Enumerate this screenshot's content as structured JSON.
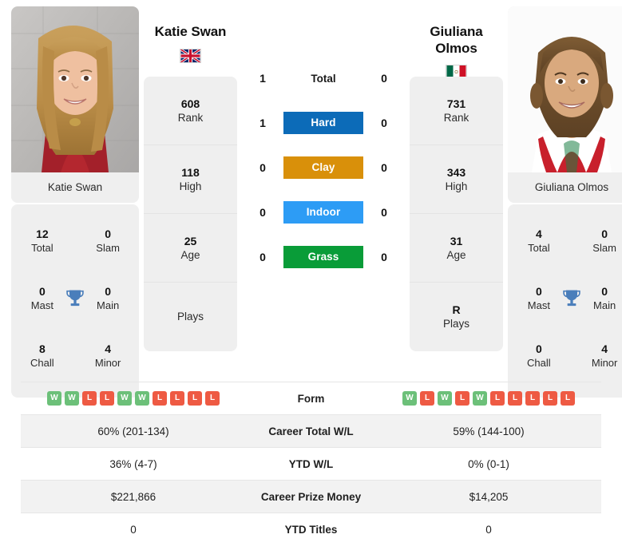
{
  "players": {
    "left": {
      "name": "Katie Swan",
      "name_line1": "Katie Swan",
      "photo_caption": "Katie Swan",
      "country": "gb-flag",
      "rank": "608",
      "rank_label": "Rank",
      "high": "118",
      "high_label": "High",
      "age": "25",
      "age_label": "Age",
      "plays": "",
      "plays_label": "Plays",
      "titles": {
        "total": "12",
        "total_label": "Total",
        "slam": "0",
        "slam_label": "Slam",
        "mast": "0",
        "mast_label": "Mast",
        "main": "0",
        "main_label": "Main",
        "chall": "8",
        "chall_label": "Chall",
        "minor": "4",
        "minor_label": "Minor"
      },
      "form": [
        "W",
        "W",
        "L",
        "L",
        "W",
        "W",
        "L",
        "L",
        "L",
        "L"
      ],
      "career_total_wl": "60% (201-134)",
      "ytd_wl": "36% (4-7)",
      "career_prize_money": "$221,866",
      "ytd_titles": "0",
      "h2h": {
        "total": "1",
        "hard": "1",
        "clay": "0",
        "indoor": "0",
        "grass": "0"
      }
    },
    "right": {
      "name": "Giuliana Olmos",
      "name_line1": "Giuliana",
      "name_line2": "Olmos",
      "photo_caption": "Giuliana Olmos",
      "country": "mx-flag",
      "rank": "731",
      "rank_label": "Rank",
      "high": "343",
      "high_label": "High",
      "age": "31",
      "age_label": "Age",
      "plays": "R",
      "plays_label": "Plays",
      "titles": {
        "total": "4",
        "total_label": "Total",
        "slam": "0",
        "slam_label": "Slam",
        "mast": "0",
        "mast_label": "Mast",
        "main": "0",
        "main_label": "Main",
        "chall": "0",
        "chall_label": "Chall",
        "minor": "4",
        "minor_label": "Minor"
      },
      "form": [
        "W",
        "L",
        "W",
        "L",
        "W",
        "L",
        "L",
        "L",
        "L",
        "L"
      ],
      "career_total_wl": "59% (144-100)",
      "ytd_wl": "0% (0-1)",
      "career_prize_money": "$14,205",
      "ytd_titles": "0",
      "h2h": {
        "total": "0",
        "hard": "0",
        "clay": "0",
        "indoor": "0",
        "grass": "0"
      }
    }
  },
  "surfaces": [
    {
      "key": "total",
      "label": "Total",
      "color": null,
      "badge": false
    },
    {
      "key": "hard",
      "label": "Hard",
      "color": "#0c6bb8",
      "badge": true
    },
    {
      "key": "clay",
      "label": "Clay",
      "color": "#d9900a",
      "badge": true
    },
    {
      "key": "indoor",
      "label": "Indoor",
      "color": "#2d9cf5",
      "badge": true
    },
    {
      "key": "grass",
      "label": "Grass",
      "color": "#099c38",
      "badge": true
    }
  ],
  "stats_rows": [
    {
      "label": "Form",
      "type": "form"
    },
    {
      "label": "Career Total W/L",
      "type": "text",
      "key": "career_total_wl"
    },
    {
      "label": "YTD W/L",
      "type": "text",
      "key": "ytd_wl"
    },
    {
      "label": "Career Prize Money",
      "type": "text",
      "key": "career_prize_money"
    },
    {
      "label": "YTD Titles",
      "type": "text",
      "key": "ytd_titles"
    }
  ],
  "colors": {
    "card_bg": "#efefef",
    "win": "#6cc079",
    "loss": "#ee5a43",
    "row_shade": "#f2f2f2"
  }
}
